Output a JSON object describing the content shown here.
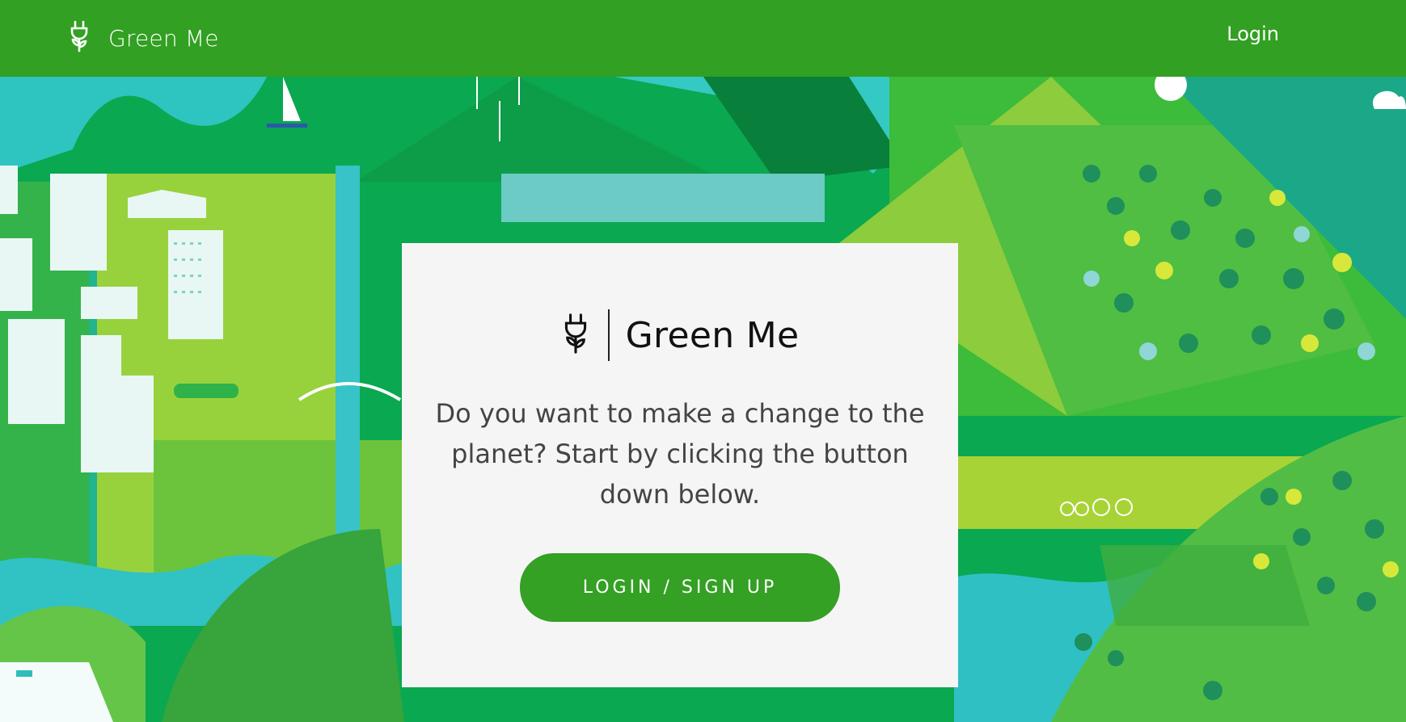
{
  "app": {
    "brand_name": "Green Me"
  },
  "navbar": {
    "login_label": "Login"
  },
  "card": {
    "brand_name": "Green Me",
    "message": "Do you want to make a change to the planet? Start by clicking the button down below.",
    "cta_label": "LOGIN / SIGN UP"
  },
  "colors": {
    "navbar": "#32a022",
    "button": "#34a024",
    "card": "#f5f5f5"
  }
}
